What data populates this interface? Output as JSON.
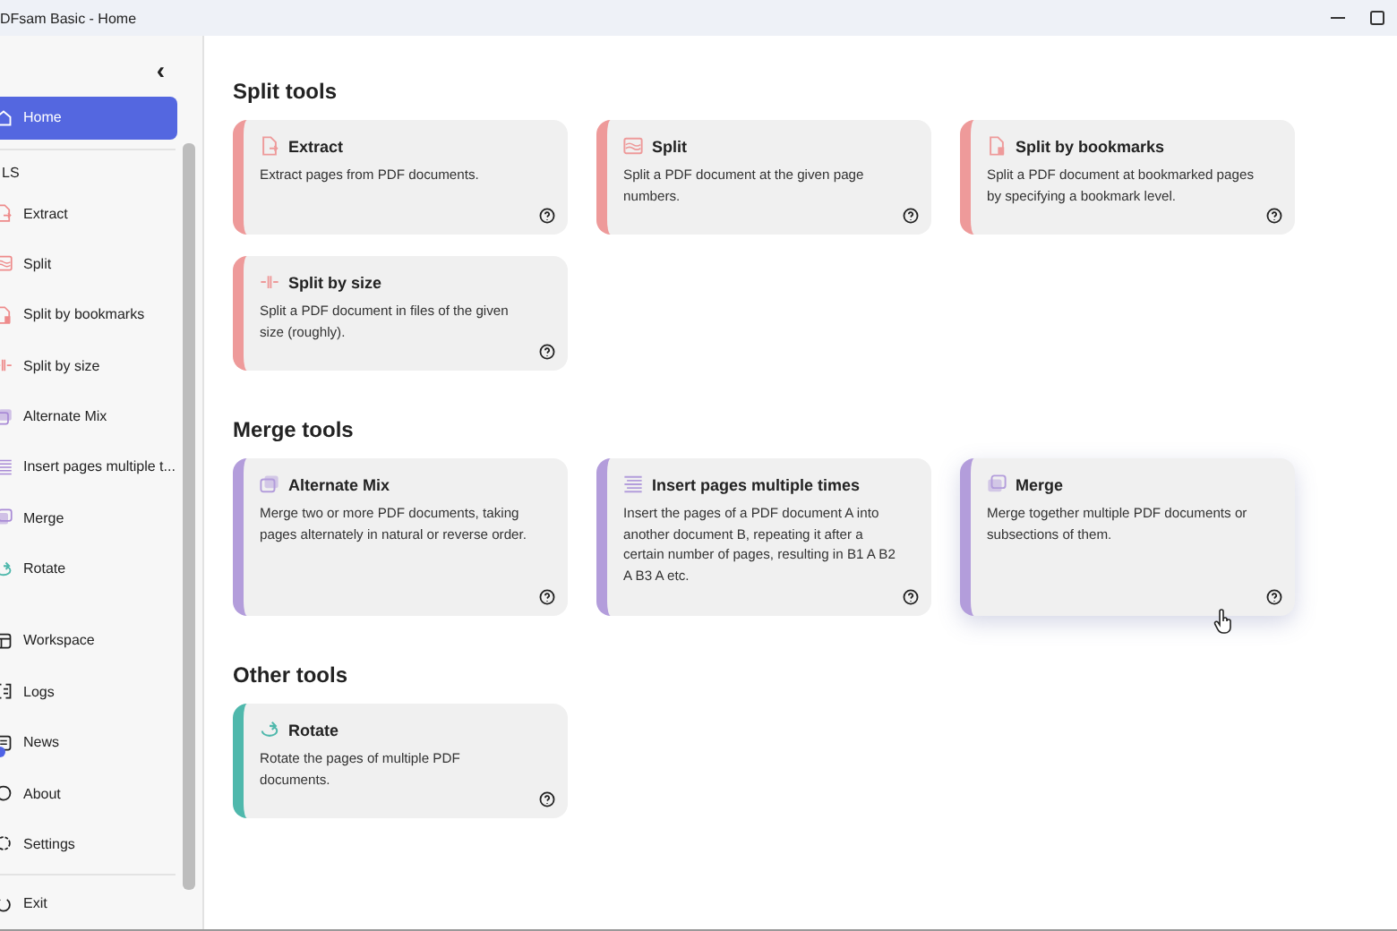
{
  "window": {
    "title": "DFsam Basic - Home"
  },
  "sidebar": {
    "collapse_label": "‹",
    "home": {
      "label": "Home",
      "selected": true
    },
    "section_label": "LS",
    "tools": [
      {
        "label": "Extract",
        "color": "#ee8b8b",
        "selected": false
      },
      {
        "label": "Split",
        "color": "#ee8b8b",
        "selected": false
      },
      {
        "label": "Split by bookmarks",
        "color": "#ee8b8b",
        "selected": false
      },
      {
        "label": "Split by size",
        "color": "#ee8b8b",
        "selected": false
      },
      {
        "label": "Alternate Mix",
        "color": "#a98bd6",
        "selected": false
      },
      {
        "label": "Insert pages multiple t...",
        "color": "#a98bd6",
        "selected": false
      },
      {
        "label": "Merge",
        "color": "#a98bd6",
        "selected": false
      },
      {
        "label": "Rotate",
        "color": "#4fb8ac",
        "selected": false
      }
    ],
    "nav": [
      {
        "label": "Workspace",
        "badge": false,
        "selected": false
      },
      {
        "label": "Logs",
        "badge": false,
        "selected": false
      },
      {
        "label": "News",
        "badge": true,
        "selected": false
      },
      {
        "label": "About",
        "badge": false,
        "selected": false
      },
      {
        "label": "Settings",
        "badge": false,
        "selected": false
      }
    ],
    "exit": {
      "label": "Exit"
    }
  },
  "sections": [
    {
      "title": "Split tools",
      "cards": [
        {
          "title": "Extract",
          "description": "Extract pages from PDF documents.",
          "color": "#ee9a9a",
          "hovered": false
        },
        {
          "title": "Split",
          "description": "Split a PDF document at the given page numbers.",
          "color": "#ee9a9a",
          "hovered": false
        },
        {
          "title": "Split by bookmarks",
          "description": "Split a PDF document at bookmarked pages by specifying a bookmark level.",
          "color": "#ee9a9a",
          "hovered": false
        },
        {
          "title": "Split by size",
          "description": "Split a PDF document in files of the given size (roughly).",
          "color": "#ee9a9a",
          "hovered": false
        }
      ]
    },
    {
      "title": "Merge tools",
      "cards": [
        {
          "title": "Alternate Mix",
          "description": "Merge two or more PDF documents, taking pages alternately in natural or reverse order.",
          "color": "#b39ddb",
          "hovered": false
        },
        {
          "title": "Insert pages multiple times",
          "description": "Insert the pages of a PDF document A into another document B, repeating it after a certain number of pages, resulting in B1 A B2 A B3 A etc.",
          "color": "#b39ddb",
          "hovered": false
        },
        {
          "title": "Merge",
          "description": "Merge together multiple PDF documents or subsections of them.",
          "color": "#b39ddb",
          "hovered": true
        }
      ]
    },
    {
      "title": "Other tools",
      "cards": [
        {
          "title": "Rotate",
          "description": "Rotate the pages of multiple PDF documents.",
          "color": "#4fb8ac",
          "hovered": false
        }
      ]
    }
  ]
}
